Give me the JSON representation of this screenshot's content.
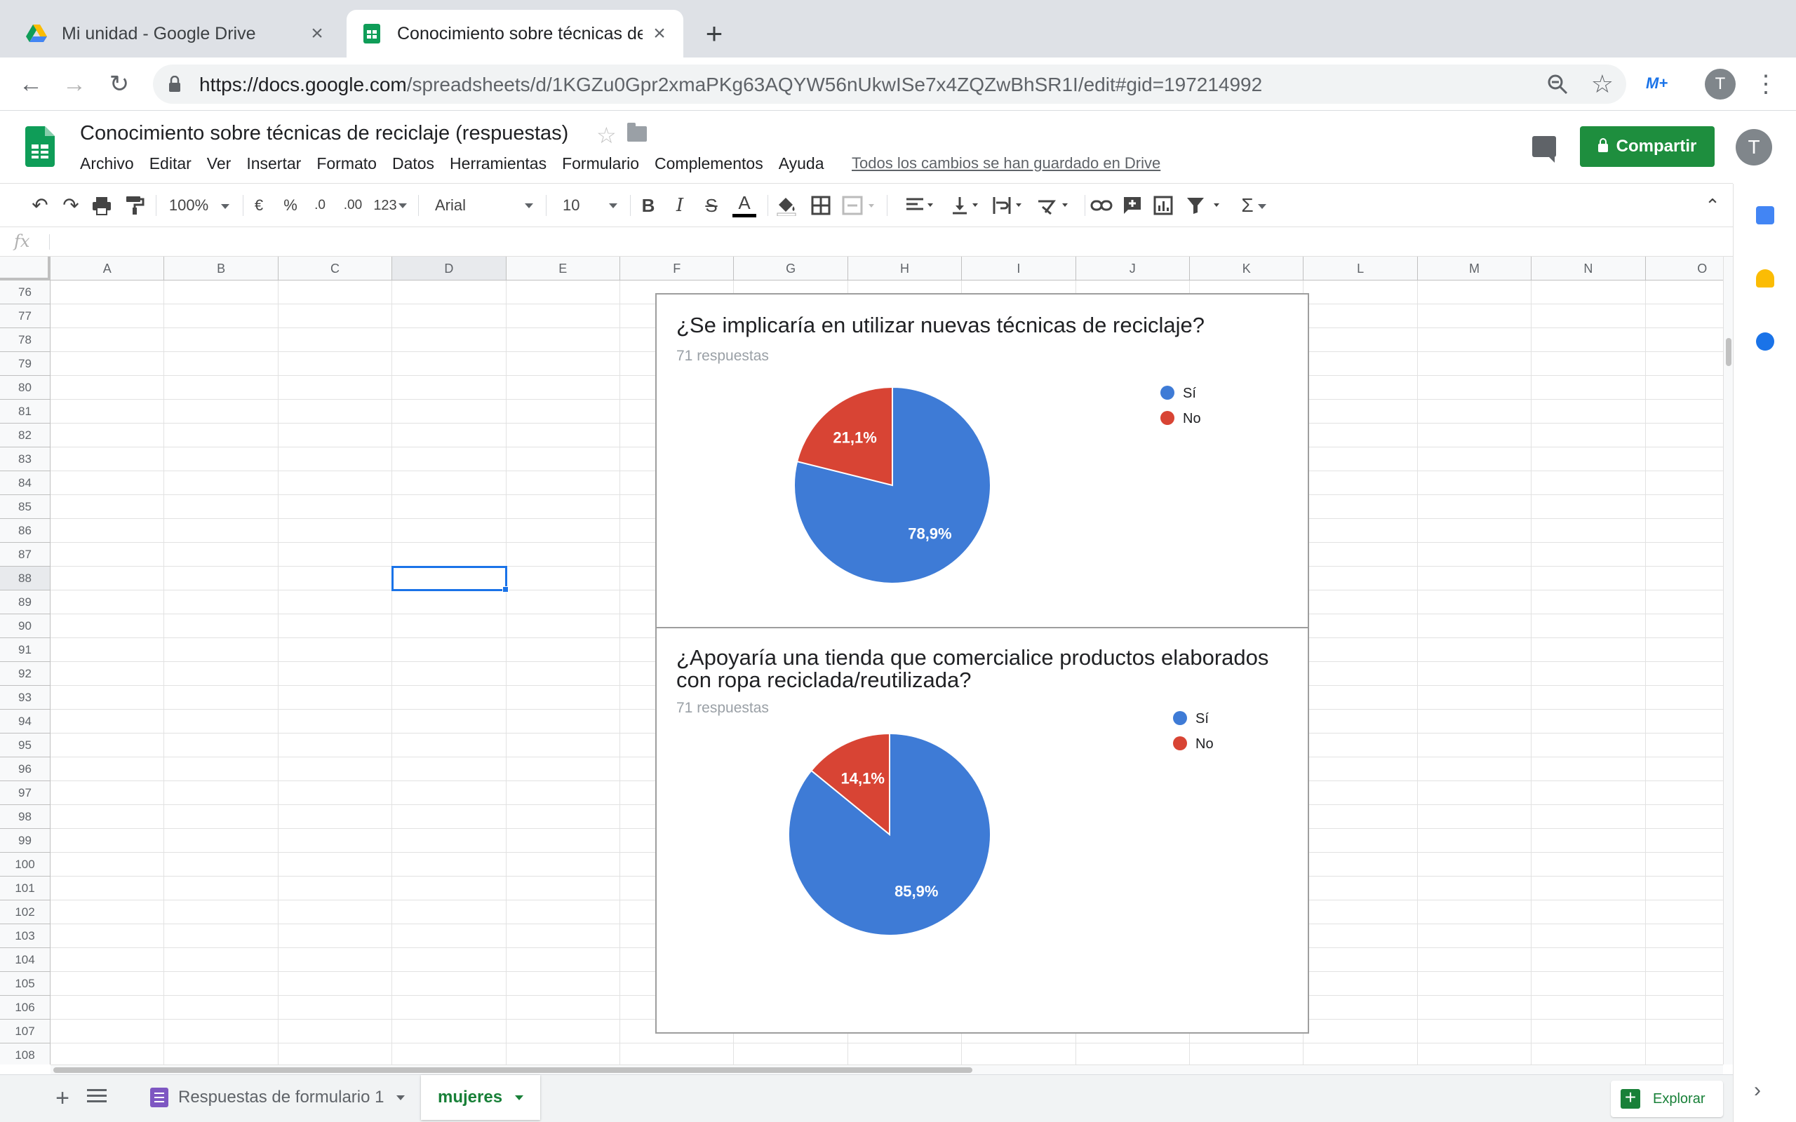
{
  "browser": {
    "tabs": [
      {
        "title": "Mi unidad - Google Drive",
        "active": false
      },
      {
        "title": "Conocimiento sobre técnicas de reciclaje (respuestas) - Hojas de cálculo de Google",
        "active": true
      }
    ],
    "url_host": "https://docs.google.com",
    "url_path": "/spreadsheets/d/1KGZu0Gpr2xmaPKg63AQYW56nUkwISe7x4ZQZwBhSR1I/edit#gid=197214992",
    "extension_label": "M+",
    "profile_initial": "T"
  },
  "sheets": {
    "doc_title": "Conocimiento sobre técnicas de reciclaje (respuestas)",
    "menu": [
      "Archivo",
      "Editar",
      "Ver",
      "Insertar",
      "Formato",
      "Datos",
      "Herramientas",
      "Formulario",
      "Complementos",
      "Ayuda"
    ],
    "save_status": "Todos los cambios se han guardado en Drive",
    "share_label": "Compartir",
    "avatar_initial": "T",
    "toolbar": {
      "zoom": "100%",
      "currency": "€",
      "percent": "%",
      "dec_decrease": ".0",
      "dec_increase": ".00",
      "more_formats": "123",
      "font": "Arial",
      "font_size": "10",
      "bold": "B",
      "italic": "I",
      "strike": "S",
      "text_color": "A",
      "sigma": "Σ"
    },
    "fx_label": "fx",
    "columns": [
      "A",
      "B",
      "C",
      "D",
      "E",
      "F",
      "G",
      "H",
      "I",
      "J",
      "K",
      "L",
      "M",
      "N",
      "O"
    ],
    "selected_column": "D",
    "first_row": 76,
    "last_row": 108,
    "selected_row": 88,
    "sheet_tabs": [
      {
        "label": "Respuestas de formulario 1",
        "active": false
      },
      {
        "label": "mujeres",
        "active": true
      }
    ],
    "explore_label": "Explorar"
  },
  "chart_data": [
    {
      "type": "pie",
      "title": "¿Se implicaría en utilizar nuevas técnicas de reciclaje?",
      "subtitle": "71 respuestas",
      "categories": [
        "Sí",
        "No"
      ],
      "values": [
        78.9,
        21.1
      ],
      "labels": [
        "78,9%",
        "21,1%"
      ],
      "colors": [
        "#3e7bd6",
        "#d84434"
      ],
      "legend": "right"
    },
    {
      "type": "pie",
      "title": "¿Apoyaría una tienda que comercialice productos elaborados con ropa reciclada/reutilizada?",
      "subtitle": "71 respuestas",
      "categories": [
        "Sí",
        "No"
      ],
      "values": [
        85.9,
        14.1
      ],
      "labels": [
        "85,9%",
        "14,1%"
      ],
      "colors": [
        "#3e7bd6",
        "#d84434"
      ],
      "legend": "right"
    }
  ]
}
